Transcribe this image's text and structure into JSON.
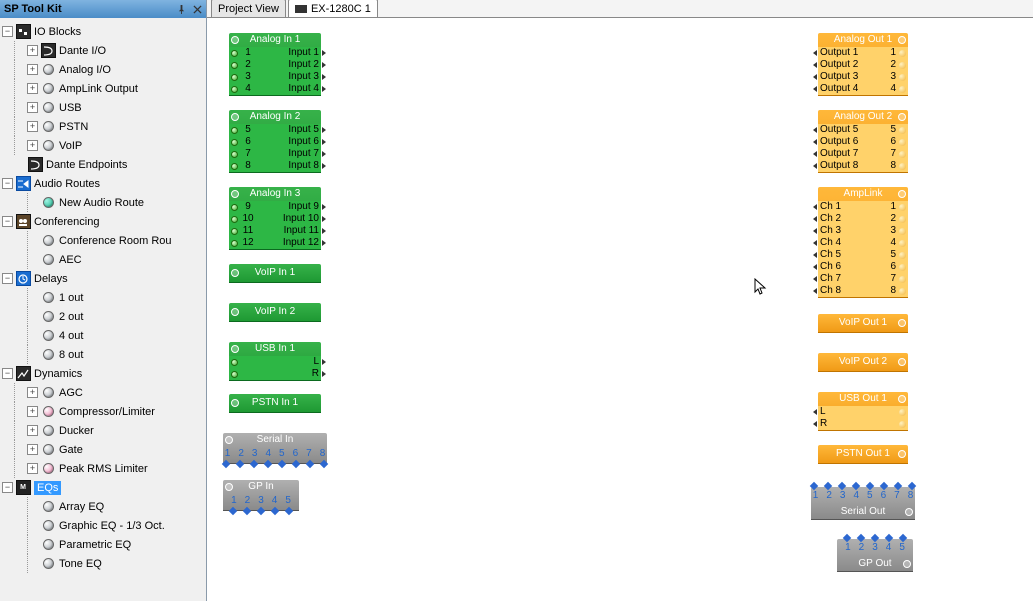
{
  "sidebar": {
    "title": "SP Tool Kit",
    "tree": {
      "io_blocks": {
        "label": "IO Blocks",
        "children": {
          "dante_io": {
            "label": "Dante I/O"
          },
          "analog_io": {
            "label": "Analog I/O"
          },
          "amplink_output": {
            "label": "AmpLink Output"
          },
          "usb": {
            "label": "USB"
          },
          "pstn": {
            "label": "PSTN"
          },
          "voip": {
            "label": "VoIP"
          }
        }
      },
      "dante_endpoints": {
        "label": "Dante Endpoints"
      },
      "audio_routes": {
        "label": "Audio Routes",
        "children": {
          "new_audio_route": {
            "label": "New Audio Route"
          }
        }
      },
      "conferencing": {
        "label": "Conferencing",
        "children": {
          "conf_room_rou": {
            "label": "Conference Room Rou"
          },
          "aec": {
            "label": "AEC"
          }
        }
      },
      "delays": {
        "label": "Delays",
        "children": {
          "d1": {
            "label": "1 out"
          },
          "d2": {
            "label": "2 out"
          },
          "d4": {
            "label": "4 out"
          },
          "d8": {
            "label": "8 out"
          }
        }
      },
      "dynamics": {
        "label": "Dynamics",
        "children": {
          "agc": {
            "label": "AGC"
          },
          "comp": {
            "label": "Compressor/Limiter"
          },
          "ducker": {
            "label": "Ducker"
          },
          "gate": {
            "label": "Gate"
          },
          "peak": {
            "label": "Peak RMS Limiter"
          }
        }
      },
      "eqs": {
        "label": "EQs",
        "children": {
          "array": {
            "label": "Array EQ"
          },
          "graphic": {
            "label": "Graphic EQ - 1/3 Oct."
          },
          "param": {
            "label": "Parametric EQ"
          },
          "tone": {
            "label": "Tone EQ"
          }
        }
      }
    }
  },
  "tabs": {
    "project": "Project View",
    "device": "EX-1280C 1"
  },
  "blocks": {
    "ain1": {
      "title": "Analog In 1",
      "rows": [
        {
          "n": "1",
          "t": "Input 1"
        },
        {
          "n": "2",
          "t": "Input 2"
        },
        {
          "n": "3",
          "t": "Input 3"
        },
        {
          "n": "4",
          "t": "Input 4"
        }
      ]
    },
    "ain2": {
      "title": "Analog In 2",
      "rows": [
        {
          "n": "5",
          "t": "Input 5"
        },
        {
          "n": "6",
          "t": "Input 6"
        },
        {
          "n": "7",
          "t": "Input 7"
        },
        {
          "n": "8",
          "t": "Input 8"
        }
      ]
    },
    "ain3": {
      "title": "Analog In 3",
      "rows": [
        {
          "n": "9",
          "t": "Input 9"
        },
        {
          "n": "10",
          "t": "Input 10"
        },
        {
          "n": "11",
          "t": "Input 11"
        },
        {
          "n": "12",
          "t": "Input 12"
        }
      ]
    },
    "voip_in1": {
      "title": "VoIP In 1"
    },
    "voip_in2": {
      "title": "VoIP In 2"
    },
    "usb_in1": {
      "title": "USB In 1",
      "rows": [
        {
          "t": "L"
        },
        {
          "t": "R"
        }
      ]
    },
    "pstn_in1": {
      "title": "PSTN In 1"
    },
    "serial_in": {
      "title": "Serial In",
      "pins": [
        "1",
        "2",
        "3",
        "4",
        "5",
        "6",
        "7",
        "8"
      ]
    },
    "gp_in": {
      "title": "GP In",
      "pins": [
        "1",
        "2",
        "3",
        "4",
        "5"
      ]
    },
    "aout1": {
      "title": "Analog Out 1",
      "rows": [
        {
          "n": "1",
          "t": "Output 1"
        },
        {
          "n": "2",
          "t": "Output 2"
        },
        {
          "n": "3",
          "t": "Output 3"
        },
        {
          "n": "4",
          "t": "Output 4"
        }
      ]
    },
    "aout2": {
      "title": "Analog Out 2",
      "rows": [
        {
          "n": "5",
          "t": "Output 5"
        },
        {
          "n": "6",
          "t": "Output 6"
        },
        {
          "n": "7",
          "t": "Output 7"
        },
        {
          "n": "8",
          "t": "Output 8"
        }
      ]
    },
    "amplink": {
      "title": "AmpLink",
      "rows": [
        {
          "n": "1",
          "t": "Ch 1"
        },
        {
          "n": "2",
          "t": "Ch 2"
        },
        {
          "n": "3",
          "t": "Ch 3"
        },
        {
          "n": "4",
          "t": "Ch 4"
        },
        {
          "n": "5",
          "t": "Ch 5"
        },
        {
          "n": "6",
          "t": "Ch 6"
        },
        {
          "n": "7",
          "t": "Ch 7"
        },
        {
          "n": "8",
          "t": "Ch 8"
        }
      ]
    },
    "voip_out1": {
      "title": "VoIP Out 1"
    },
    "voip_out2": {
      "title": "VoIP Out 2"
    },
    "usb_out1": {
      "title": "USB Out 1",
      "rows": [
        {
          "t": "L"
        },
        {
          "t": "R"
        }
      ]
    },
    "pstn_out1": {
      "title": "PSTN Out 1"
    },
    "serial_out": {
      "title": "Serial Out",
      "pins": [
        "1",
        "2",
        "3",
        "4",
        "5",
        "6",
        "7",
        "8"
      ]
    },
    "gp_out": {
      "title": "GP Out",
      "pins": [
        "1",
        "2",
        "3",
        "4",
        "5"
      ]
    }
  }
}
